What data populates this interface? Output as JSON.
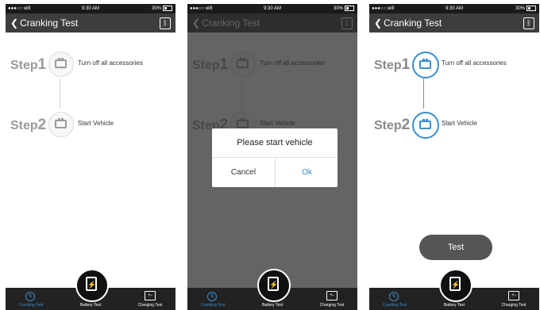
{
  "statusbar": {
    "carrier": "●●●○○ wifi",
    "wifi_icon": "wifi-icon",
    "time": "9:30 AM",
    "battery": "30%"
  },
  "navbar": {
    "title": "Cranking Test",
    "back_icon": "chevron-left-icon",
    "bluetooth_icon": "bluetooth-icon",
    "bluetooth_glyph": "ᛒ"
  },
  "steps": [
    {
      "label": "Step",
      "number": "1",
      "text": "Turn off all accessories"
    },
    {
      "label": "Step",
      "number": "2",
      "text": "Start Vehicle"
    }
  ],
  "dialog": {
    "message": "Please start vehicle",
    "cancel": "Cancel",
    "ok": "Ok"
  },
  "test_button": "Test",
  "tabs": [
    {
      "label": "Cranking Test",
      "icon": "gauge-icon",
      "glyph": "↯"
    },
    {
      "label": "Battery Test",
      "icon": "battery-test-icon",
      "glyph": "⚡"
    },
    {
      "label": "Charging Test",
      "icon": "charging-icon",
      "glyph": "+-"
    }
  ],
  "colors": {
    "accent": "#3a8ed0",
    "navbar": "#3d3d3d",
    "tabbar": "#222222"
  }
}
